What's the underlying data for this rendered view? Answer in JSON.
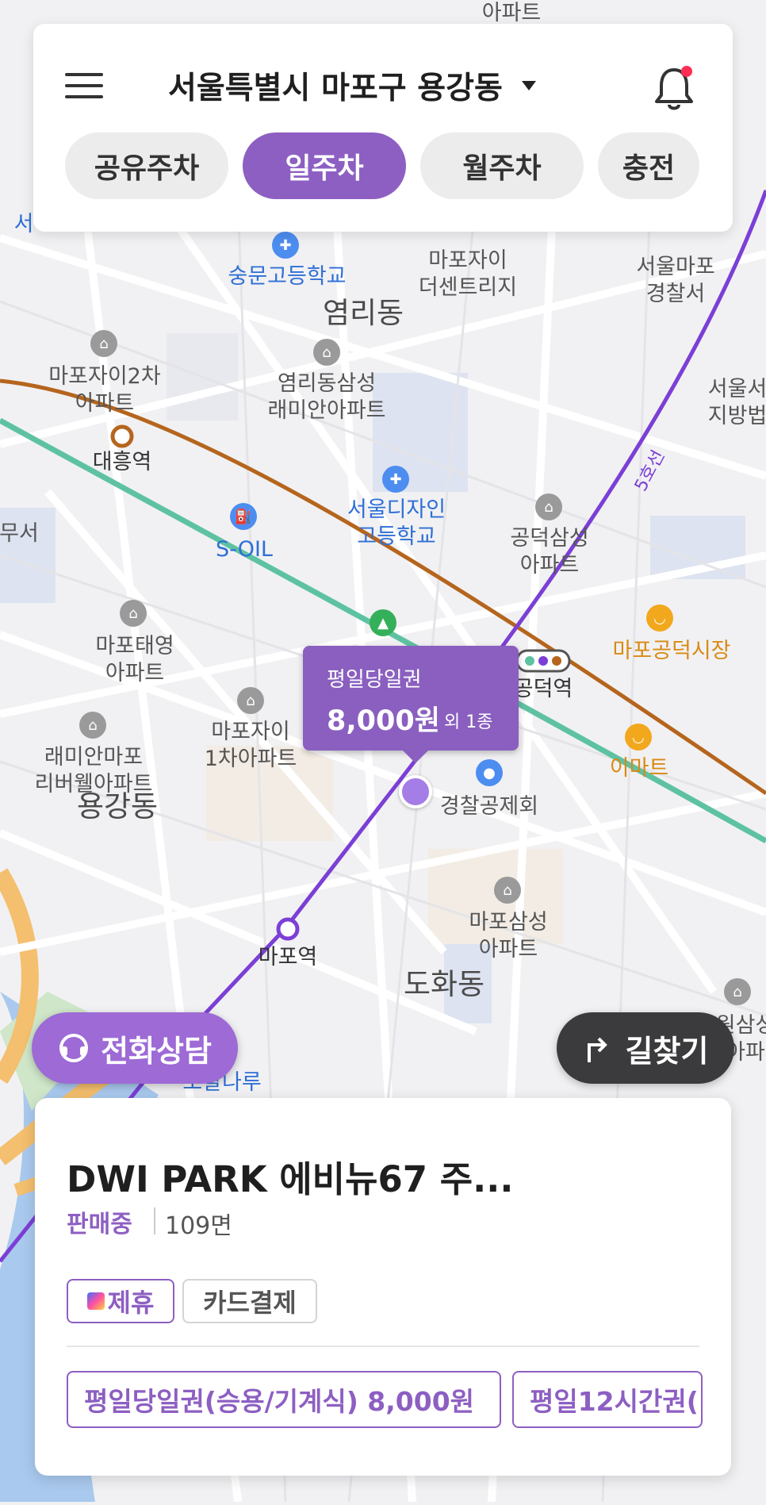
{
  "header": {
    "location": "서울특별시 마포구 용강동",
    "tabs": [
      {
        "label": "공유주차",
        "active": false
      },
      {
        "label": "일주차",
        "active": true
      },
      {
        "label": "월주차",
        "active": false
      },
      {
        "label": "충전",
        "active": false
      }
    ],
    "icons": {
      "menu": "menu-icon",
      "dropdown": "caret-down-icon",
      "notifications": "bell-icon"
    }
  },
  "map": {
    "labels": {
      "top_apt": "아파트",
      "hanla": "서",
      "mapo_xi_the_sentrige": "마포자이\n더센트리지",
      "school_sungmun": "숭문고등학교",
      "police_mapo": "서울마포\n경찰서",
      "yeomni_dong": "염리동",
      "mapo_xi2": "마포자이2차\n아파트",
      "yeomni_samsung": "염리동삼성\n래미안아파트",
      "seoul_court": "서울서\n지방법",
      "daeheung_station": "대흥역",
      "design_school": "서울디자인\n고등학교",
      "soil": "S-OIL",
      "gongdeok_samsung": "공덕삼성\n아파트",
      "line5": "5호선",
      "museo": "무서",
      "mapo_taeyoung": "마포태영\n아파트",
      "gongdeok_market": "마포공덕시장",
      "gongdeok_station": "공덕역",
      "mapo_xi1": "마포자이\n1차아파트",
      "raemian_mapo": "래미안마포\n리버웰아파트",
      "emart": "이마트",
      "yonggang_dong": "용강동",
      "police_mutual": "경찰공제회",
      "mapo_samsung": "마포삼성\n아파트",
      "mapo_station": "마포역",
      "dohwa_dong": "도화동",
      "right_samsung": "원삼성\n아파",
      "bottom_label": "오랄나루"
    }
  },
  "price_popup": {
    "ticket_name": "평일당일권",
    "price": "8,000원",
    "extra": "외 1종"
  },
  "buttons": {
    "consult": "전화상담",
    "directions": "길찾기"
  },
  "lot": {
    "name": "DWI PARK 에비뉴67 주...",
    "status": "판매중",
    "spaces": "109면",
    "tags": [
      "제휴",
      "카드결제"
    ],
    "tickets": [
      "평일당일권(승용/기계식) 8,000원",
      "평일12시간권("
    ]
  },
  "colors": {
    "accent": "#8d5fc2",
    "nav_button": "#3b3b3d",
    "subway_line5": "#7b3fd6",
    "subway_line6": "#b5651d",
    "notification_dot": "#ff2d55"
  }
}
